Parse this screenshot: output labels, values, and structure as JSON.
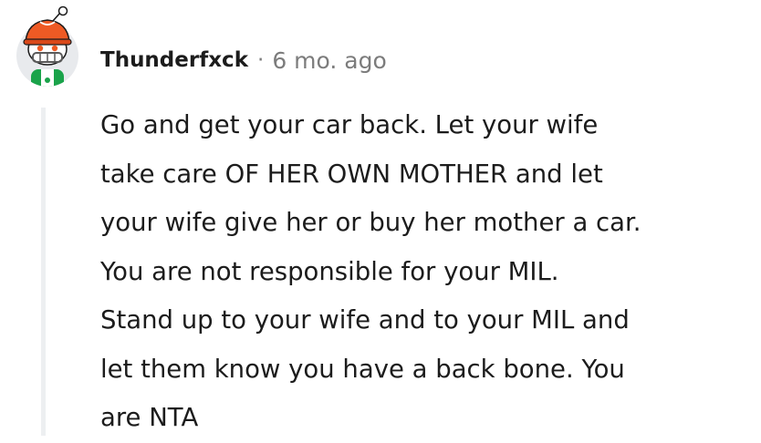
{
  "comment": {
    "author": "Thunderfxck",
    "separator": "·",
    "age": "6 mo. ago",
    "avatar_icon": "snoo-avatar-icon",
    "body_lines": [
      "Go and get your car back. Let your wife",
      "take care OF HER OWN MOTHER and let",
      "your wife give her or buy her mother a car.",
      "You are not responsible for your MIL.",
      "Stand up to your wife and to your MIL and",
      "let them know you have a back bone. You",
      "are NTA"
    ]
  },
  "colors": {
    "text": "#1c1c1c",
    "meta": "#7c7c7c",
    "thread_line": "#edeff1",
    "avatar_bg": "#e8eaed",
    "helmet": "#ee5a24",
    "shirt": "#1aa34a"
  }
}
